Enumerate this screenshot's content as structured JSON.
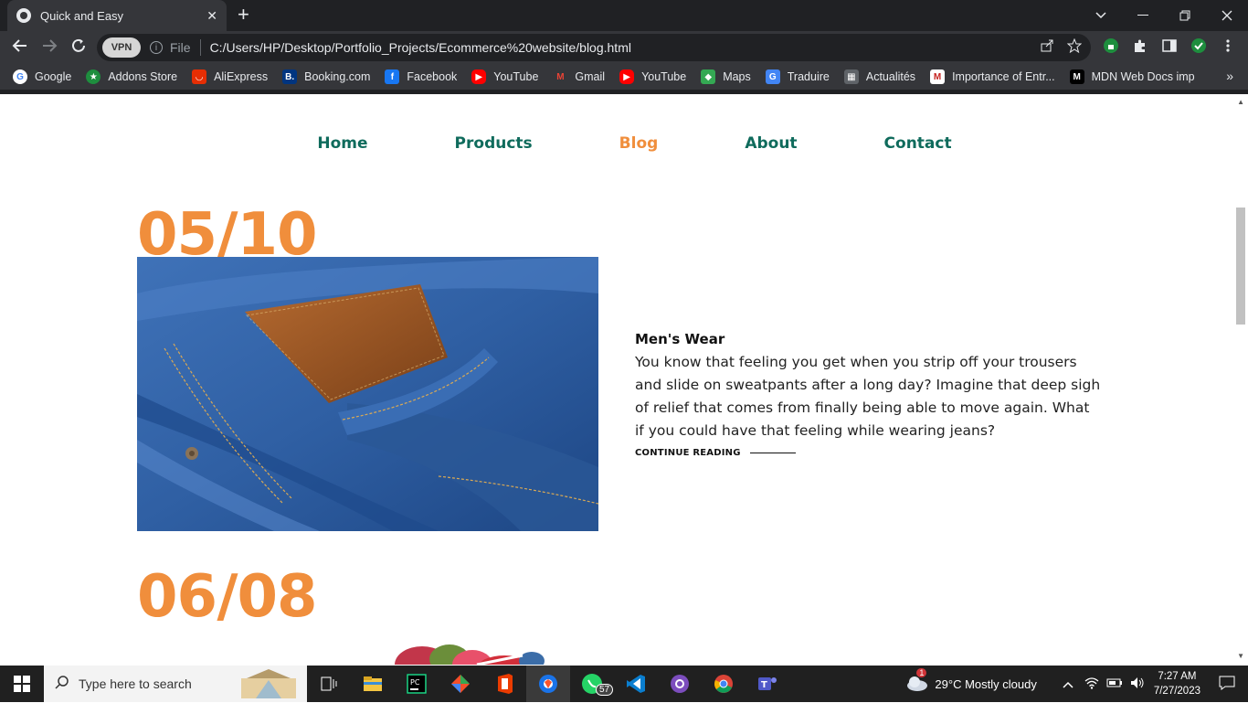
{
  "browser": {
    "tab_title": "Quick and Easy",
    "tab_close": "✕",
    "new_tab": "+",
    "vpn_label": "VPN",
    "scheme_label": "File",
    "url": "C:/Users/HP/Desktop/Portfolio_Projects/Ecommerce%20website/blog.html",
    "bookmarks": [
      {
        "label": "Google",
        "icon": "google-icon",
        "color": "#ffffff"
      },
      {
        "label": "Addons Store",
        "icon": "addons-icon",
        "color": "#1e8e3e"
      },
      {
        "label": "AliExpress",
        "icon": "aliexpress-icon",
        "color": "#e62e04"
      },
      {
        "label": "Booking.com",
        "icon": "booking-icon",
        "color": "#003580"
      },
      {
        "label": "Facebook",
        "icon": "facebook-icon",
        "color": "#1877f2"
      },
      {
        "label": "YouTube",
        "icon": "youtube-icon",
        "color": "#ff0000"
      },
      {
        "label": "Gmail",
        "icon": "gmail-icon",
        "color": "#ea4335"
      },
      {
        "label": "YouTube",
        "icon": "youtube-icon",
        "color": "#ff0000"
      },
      {
        "label": "Maps",
        "icon": "maps-icon",
        "color": "#34a853"
      },
      {
        "label": "Traduire",
        "icon": "translate-icon",
        "color": "#4285f4"
      },
      {
        "label": "Actualités",
        "icon": "news-icon",
        "color": "#4285f4"
      },
      {
        "label": "Importance of Entr...",
        "icon": "gmail-icon",
        "color": "#c5221f"
      },
      {
        "label": "MDN Web Docs imp",
        "icon": "mdn-icon",
        "color": "#000000"
      }
    ]
  },
  "site": {
    "nav": [
      {
        "label": "Home",
        "active": false
      },
      {
        "label": "Products",
        "active": false
      },
      {
        "label": "Blog",
        "active": true
      },
      {
        "label": "About",
        "active": false
      },
      {
        "label": "Contact",
        "active": false
      }
    ],
    "posts": [
      {
        "date": "05/10",
        "title": "Men's Wear",
        "text": "You know that feeling you get when you strip off your trousers and slide on sweatpants after a long day? Imagine that deep sigh of relief that comes from finally being able to move again. What if you could have that feeling while wearing jeans?",
        "cta": "CONTINUE READING"
      },
      {
        "date": "06/08"
      }
    ],
    "accent_color": "#f08e3c",
    "nav_color": "#0f6b5c"
  },
  "taskbar": {
    "search_placeholder": "Type here to search",
    "whatsapp_badge": "57",
    "weather_badge": "1",
    "weather": "29°C  Mostly cloudy",
    "time": "7:27 AM",
    "date": "7/27/2023"
  }
}
